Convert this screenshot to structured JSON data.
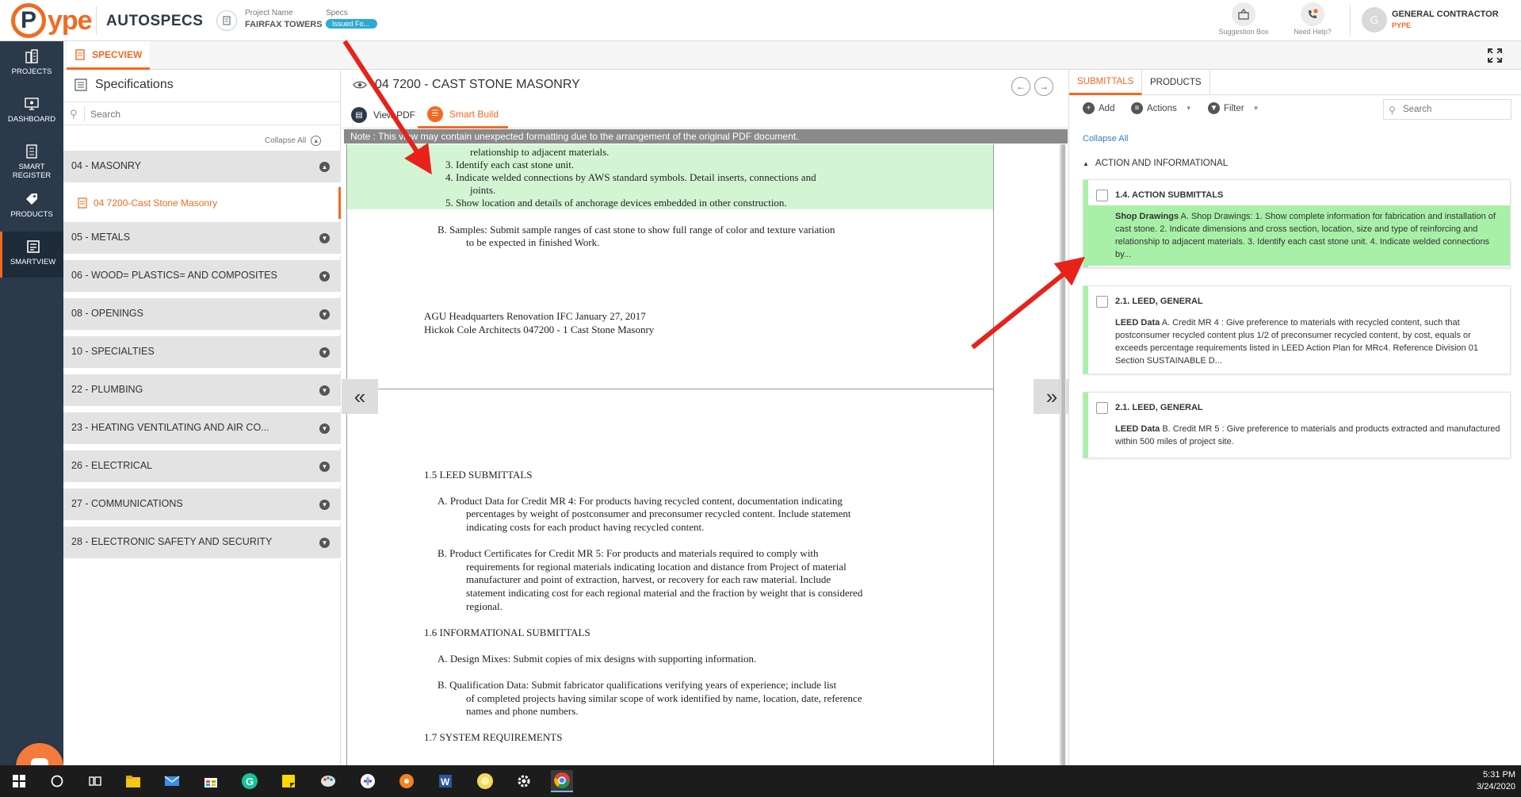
{
  "header": {
    "logo_text": "ype",
    "logo_p": "P",
    "app_name": "AUTOSPECS",
    "project_label": "Project Name",
    "project_name": "FAIRFAX TOWERS",
    "specs_label": "Specs",
    "specs_status": "Issued Fo...",
    "suggestion_box": "Suggestion Box",
    "need_help": "Need Help?",
    "user_initial": "G",
    "user_role": "GENERAL CONTRACTOR",
    "user_org": "PYPE"
  },
  "leftnav": {
    "items": [
      {
        "label": "PROJECTS",
        "icon": "building-icon"
      },
      {
        "label": "DASHBOARD",
        "icon": "monitor-icon"
      },
      {
        "label": "SMART REGISTER",
        "icon": "register-icon"
      },
      {
        "label": "PRODUCTS",
        "icon": "tag-icon"
      },
      {
        "label": "SMARTVIEW",
        "icon": "smartview-icon"
      }
    ],
    "active": "SMARTVIEW"
  },
  "tabbar": {
    "specview": "SPECVIEW"
  },
  "specs_panel": {
    "title": "Specifications",
    "search_placeholder": "Search",
    "collapse_all": "Collapse All",
    "sections": [
      {
        "label": "04 - MASONRY",
        "expanded": true
      },
      {
        "label": "05 - METALS"
      },
      {
        "label": "06 - WOOD= PLASTICS= AND COMPOSITES"
      },
      {
        "label": "08 - OPENINGS"
      },
      {
        "label": "10 - SPECIALTIES"
      },
      {
        "label": "22 - PLUMBING"
      },
      {
        "label": "23 - HEATING VENTILATING AND AIR CO..."
      },
      {
        "label": "26 - ELECTRICAL"
      },
      {
        "label": "27 - COMMUNICATIONS"
      },
      {
        "label": "28 - ELECTRONIC SAFETY AND SECURITY"
      }
    ],
    "active_item": "04 7200-Cast Stone Masonry"
  },
  "document": {
    "title": "04 7200 - CAST STONE MASONRY",
    "tabs": {
      "view_pdf": "View PDF",
      "smart_build": "Smart Build"
    },
    "note": "Note : This view may contain unexpected formatting due to the arrangement of the original PDF document.",
    "page1": {
      "highlight_lines": [
        "relationship to adjacent materials.",
        "3. Identify each cast stone unit.",
        "4. Indicate welded connections by AWS standard symbols. Detail inserts, connections and",
        "joints.",
        "5. Show location and details of anchorage devices embedded in other construction."
      ],
      "samples": [
        "B. Samples: Submit sample ranges of cast stone to show full range of color and texture variation",
        "to be expected in finished Work."
      ],
      "footer": [
        "AGU Headquarters Renovation IFC January 27, 2017",
        "Hickok Cole Architects 047200 - 1 Cast Stone Masonry"
      ]
    },
    "page2": {
      "lines": [
        "1.5 LEED SUBMITTALS",
        "A. Product Data for Credit MR 4: For products having recycled content, documentation indicating",
        "percentages by weight of postconsumer and preconsumer recycled content. Include statement",
        "indicating costs for each product having recycled content.",
        "B. Product Certificates for Credit MR 5: For products and materials required to comply with",
        "requirements for regional materials indicating location and distance from Project of material",
        "manufacturer and point of extraction, harvest, or recovery for each raw material. Include",
        "statement indicating cost for each regional material and the fraction by weight that is considered",
        "regional.",
        "1.6 INFORMATIONAL SUBMITTALS",
        "A. Design Mixes: Submit copies of mix designs with supporting information.",
        "B. Qualification Data: Submit fabricator qualifications verifying years of experience; include list",
        "of completed projects having similar scope of work identified by name, location, date, reference",
        "names and phone numbers.",
        "1.7 SYSTEM REQUIREMENTS"
      ]
    }
  },
  "submittals_panel": {
    "tabs": [
      "SUBMITTALS",
      "PRODUCTS"
    ],
    "active_tab": "SUBMITTALS",
    "toolbar": {
      "add": "Add",
      "actions": "Actions",
      "filter": "Filter",
      "search_placeholder": "Search"
    },
    "collapse_all": "Collapse All",
    "group": "ACTION AND INFORMATIONAL",
    "cards": [
      {
        "title": "1.4. ACTION SUBMITTALS",
        "type": "Shop Drawings",
        "text": "A. Shop Drawings: 1. Show complete information for fabrication and installation of cast stone. 2. Indicate dimensions and cross section, location, size and type of reinforcing and relationship to adjacent materials. 3. Identify each cast stone unit. 4. Indicate welded connections by...",
        "selected": true
      },
      {
        "title": "2.1. LEED, GENERAL",
        "type": "LEED Data",
        "text": "A. Credit MR 4 : Give preference to materials with recycled content, such that postconsumer recycled content plus 1/2 of preconsumer recycled content, by cost, equals or exceeds percentage requirements listed in LEED Action Plan for MRc4. Reference Division 01 Section SUSTAINABLE D..."
      },
      {
        "title": "2.1. LEED, GENERAL",
        "type": "LEED Data",
        "text": "B. Credit MR 5 : Give preference to materials and products extracted and manufactured within 500 miles of project site."
      }
    ]
  },
  "taskbar": {
    "time": "5:31 PM",
    "date": "3/24/2020",
    "icons": [
      "windows-start-icon",
      "search-circle-icon",
      "task-view-icon",
      "file-explorer-icon",
      "mail-icon",
      "store-icon",
      "grammarly-icon",
      "sticky-notes-icon",
      "paint-icon",
      "slack-icon",
      "settings-flower-icon",
      "word-icon",
      "photos-icon",
      "gear-icon",
      "chrome-icon"
    ]
  },
  "colors": {
    "brand": "#f26a21",
    "nav": "#2b3a4a",
    "highlight": "#a8f0a8",
    "arrow": "#e8211b"
  }
}
